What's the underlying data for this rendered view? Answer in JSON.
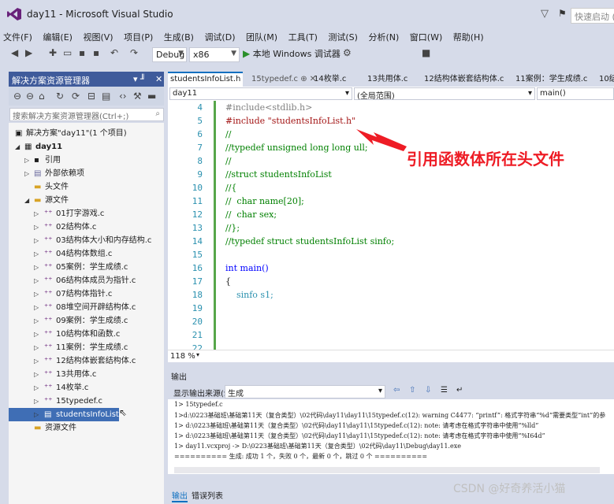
{
  "window": {
    "title": "day11 - Microsoft Visual Studio",
    "quick_launch": "快速启动 (Ctrl"
  },
  "menu": [
    "文件(F)",
    "编辑(E)",
    "视图(V)",
    "项目(P)",
    "生成(B)",
    "调试(D)",
    "团队(M)",
    "工具(T)",
    "测试(S)",
    "分析(N)",
    "窗口(W)",
    "帮助(H)"
  ],
  "toolbar": {
    "config": "Debug",
    "platform": "x86",
    "run_label": "本地 Windows 调试器"
  },
  "solution_explorer": {
    "title": "解决方案资源管理器",
    "pin": "▾ ╜",
    "close": "✕",
    "search_placeholder": "搜索解决方案资源管理器(Ctrl+;)",
    "solution_label": "解决方案\"day11\"(1 个项目)",
    "project": "day11",
    "nodes": {
      "references": "引用",
      "external": "外部依赖项",
      "headers": "头文件",
      "sources": "源文件",
      "resources": "资源文件"
    },
    "source_files": [
      "01打字游戏.c",
      "02结构体.c",
      "03结构体大小和内存结构.c",
      "04结构体数组.c",
      "05案例：学生成绩.c",
      "06结构体成员为指针.c",
      "07结构体指针.c",
      "08堆空间开辟结构体.c",
      "09案例：学生成绩.c",
      "10结构体和函数.c",
      "11案例：学生成绩.c",
      "12结构体嵌套结构体.c",
      "13共用体.c",
      "14枚举.c",
      "15typedef.c"
    ],
    "selected_file": "studentsInfoList.h"
  },
  "editor": {
    "tabs": [
      "studentsInfoList.h",
      "15typedef.c",
      "14枚举.c",
      "13共用体.c",
      "12结构体嵌套结构体.c",
      "11案例：学生成绩.c",
      "10结"
    ],
    "tab_pin": "⊕ ✕",
    "nav_project": "day11",
    "nav_scope": "(全局范围)",
    "nav_function": "main()",
    "zoom": "118 %",
    "lines": [
      {
        "n": "4",
        "text": "#include<stdlib.h>",
        "cls": "pre"
      },
      {
        "n": "5",
        "text": "#include \"studentsInfoList.h\"",
        "cls": "str"
      },
      {
        "n": "6",
        "text": "//",
        "cls": "comment"
      },
      {
        "n": "7",
        "text": "//typedef unsigned long long ull;",
        "cls": "comment"
      },
      {
        "n": "8",
        "text": "//",
        "cls": "comment"
      },
      {
        "n": "9",
        "text": "//struct studentsInfoList",
        "cls": "comment"
      },
      {
        "n": "10",
        "text": "//{",
        "cls": "comment"
      },
      {
        "n": "11",
        "text": "//  char name[20];",
        "cls": "comment"
      },
      {
        "n": "12",
        "text": "//  char sex;",
        "cls": "comment"
      },
      {
        "n": "13",
        "text": "//};",
        "cls": "comment"
      },
      {
        "n": "14",
        "text": "//typedef struct studentsInfoList sinfo;",
        "cls": "comment"
      },
      {
        "n": "15",
        "text": "",
        "cls": ""
      },
      {
        "n": "16",
        "text": "int main()",
        "cls": "kw"
      },
      {
        "n": "17",
        "text": "{",
        "cls": ""
      },
      {
        "n": "18",
        "text": "    sinfo s1;",
        "cls": "type"
      },
      {
        "n": "19",
        "text": "",
        "cls": ""
      },
      {
        "n": "20",
        "text": "",
        "cls": ""
      },
      {
        "n": "21",
        "text": "",
        "cls": ""
      },
      {
        "n": "22",
        "text": "",
        "cls": ""
      }
    ]
  },
  "annotation": "引用函数体所在头文件",
  "output": {
    "title": "输出",
    "source_label": "显示输出来源(S):",
    "source_value": "生成",
    "lines": [
      "1>  15typedef.c",
      "1>d:\\0223基础班\\基础第11天（复合类型）\\02代码\\day11\\day11\\15typedef.c(12): warning C4477: “printf”: 格式字符串“%d”需要类型“int”的参",
      "1>  d:\\0223基础班\\基础第11天（复合类型）\\02代码\\day11\\day11\\15typedef.c(12): note: 请考虑在格式字符串中使用“%lld”",
      "1>  d:\\0223基础班\\基础第11天（复合类型）\\02代码\\day11\\day11\\15typedef.c(12): note: 请考虑在格式字符串中使用“%I64d”",
      "1>  day11.vcxproj -> D:\\0223基础班\\基础第11天（复合类型）\\02代码\\day11\\Debug\\day11.exe",
      "========== 生成: 成功 1 个，失败 0 个，最新 0 个，跳过 0 个 =========="
    ],
    "tabs": [
      "输出",
      "错误列表"
    ]
  },
  "watermark": "CSDN @好奇养活小猫",
  "colors": {
    "accent": "#3f6eb5",
    "annotation": "#ee1c25",
    "comment": "#008000"
  }
}
